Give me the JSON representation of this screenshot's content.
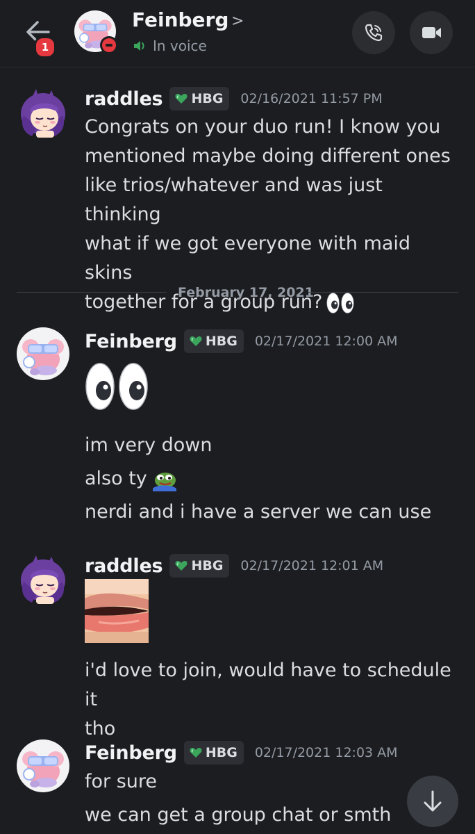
{
  "header": {
    "unread_count": "1",
    "name": "Feinberg",
    "status": "In voice",
    "icons": [
      "back-arrow-icon",
      "call-icon",
      "video-icon",
      "speaker-icon",
      "chevron-right-icon"
    ]
  },
  "divider": {
    "label": "February 17, 2021"
  },
  "messages": [
    {
      "author": "raddles",
      "tag": "HBG",
      "timestamp": "02/16/2021 11:57 PM",
      "lines": [
        "Congrats on your duo run! I know you",
        "mentioned maybe doing different ones",
        "like trios/whatever and was just thinking",
        "what if we got everyone with maid skins",
        "together for a group run?"
      ]
    },
    {
      "author": "Feinberg",
      "tag": "HBG",
      "timestamp": "02/17/2021 12:00 AM",
      "lines": [
        "im very down",
        "also ty",
        "nerdi and i have a server we can use"
      ]
    },
    {
      "author": "raddles",
      "tag": "HBG",
      "timestamp": "02/17/2021 12:01 AM",
      "lines": [
        "i'd love to join, would have to schedule it",
        "tho"
      ]
    },
    {
      "author": "Feinberg",
      "tag": "HBG",
      "timestamp": "02/17/2021 12:03 AM",
      "lines": [
        "for sure",
        "we can get a group chat or smth"
      ]
    }
  ],
  "colors": {
    "background": "#1c1d21",
    "tag_heart": "#3ba55c",
    "badge": "#e5383f",
    "voice": "#3ba55c"
  }
}
